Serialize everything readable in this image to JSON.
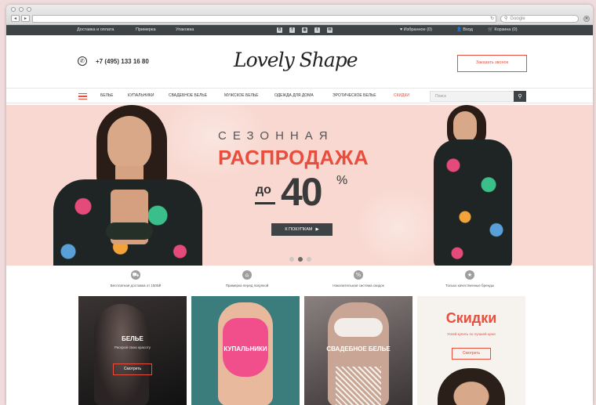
{
  "browser": {
    "search_placeholder": "Google",
    "back_glyph": "◂",
    "forward_glyph": "▸",
    "refresh_glyph": "↻",
    "close_glyph": "✕",
    "search_glyph": "⚲"
  },
  "topbar": {
    "links": [
      "Доставка и оплата",
      "Примерка",
      "Упаковка"
    ],
    "social_icons": [
      "B",
      "f",
      "◉",
      "t",
      "✉"
    ],
    "favorites": "♥ Избранное (0)",
    "login": "👤 Вход",
    "cart": "🛒 Корзина (0)"
  },
  "header": {
    "phone_glyph": "✆",
    "phone": "+7 (495) 133 16 80",
    "logo": "Lovely Shape",
    "call_button": "Заказать звонок"
  },
  "nav": {
    "items": [
      "БЕЛЬЕ",
      "КУПАЛЬНИКИ",
      "СВАДЕБНОЕ БЕЛЬЕ",
      "МУЖСКОЕ БЕЛЬЕ",
      "ОДЕЖДА ДЛЯ ДОМА",
      "ЭРОТИЧЕСКОЕ БЕЛЬЕ",
      "СКИДКИ"
    ],
    "search_placeholder": "Поиск",
    "search_glyph": "⚲"
  },
  "hero": {
    "line1": "СЕЗОННАЯ",
    "line2": "РАСПРОДАЖА",
    "do": "до",
    "percent_value": "40",
    "percent_sign": "%",
    "button": "К ПОКУПКАМ",
    "button_arrow": "▶",
    "slides": 3,
    "active_slide": 2
  },
  "features": [
    {
      "icon": "truck-icon",
      "glyph": "⛟",
      "text": "Бесплатная доставка от 1500₽"
    },
    {
      "icon": "hanger-icon",
      "glyph": "⌂",
      "text": "Примерка перед покупкой"
    },
    {
      "icon": "percent-icon",
      "glyph": "%",
      "text": "Накопительная система скидок"
    },
    {
      "icon": "star-icon",
      "glyph": "★",
      "text": "Только качественные бренды"
    }
  ],
  "cards": [
    {
      "title": "БЕЛЬЕ",
      "subtitle": "Раскрой свою красоту",
      "button": "Смотреть"
    },
    {
      "title": "КУПАЛЬНИКИ"
    },
    {
      "title": "СВАДЕБНОЕ БЕЛЬЕ"
    },
    {
      "title": "Скидки",
      "subtitle": "Успей купить по лучшей цене",
      "button": "Смотреть"
    }
  ],
  "colors": {
    "accent": "#e94e3d",
    "dark": "#3e4446",
    "hero_bg": "#f8d8d0"
  }
}
